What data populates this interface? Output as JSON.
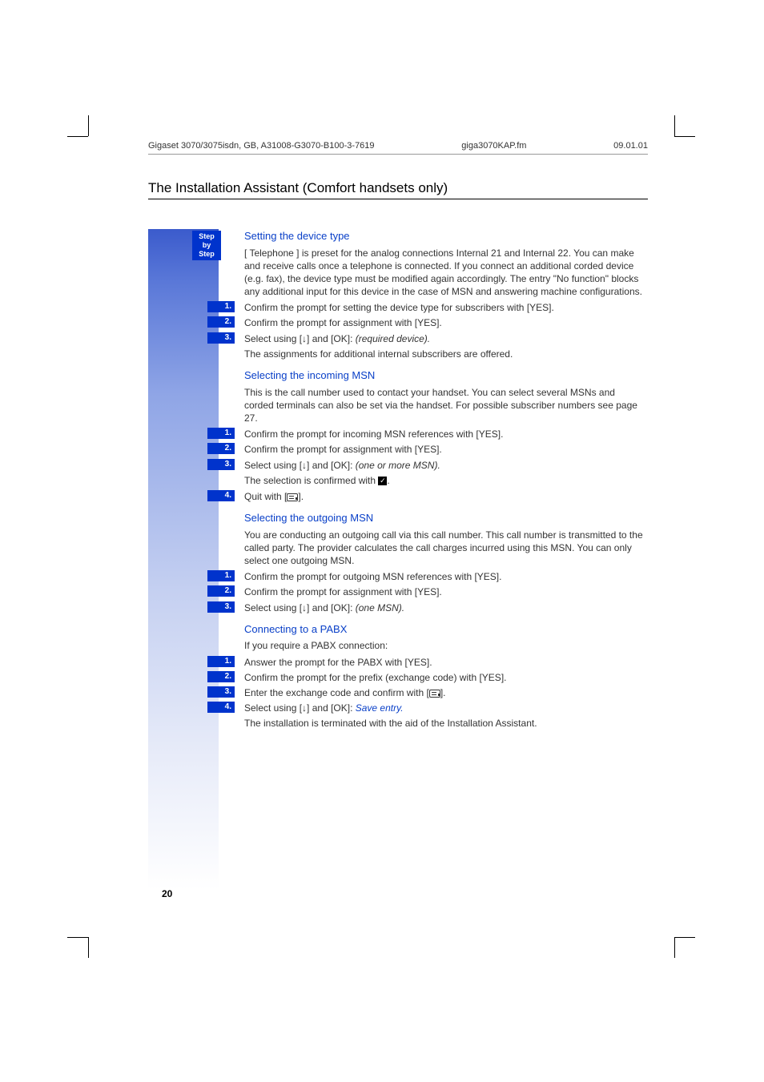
{
  "header": {
    "left": "Gigaset 3070/3075isdn, GB, A31008-G3070-B100-3-7619",
    "mid": "giga3070KAP.fm",
    "right": "09.01.01"
  },
  "section_title": "The Installation Assistant (Comfort handsets only)",
  "badge": {
    "l1": "Step",
    "l2": "by",
    "l3": "Step"
  },
  "s1": {
    "title": "Setting the device type",
    "intro": "[ Telephone ] is preset for the analog connections Internal 21 and Internal 22. You can make and receive calls once a telephone is connected. If you connect an additional corded device (e.g. fax), the device type must be modified again accordingly. The entry \"No function\" blocks any additional input for this device in the case of MSN and answering machine configurations.",
    "r1": "Confirm the prompt for setting the device type for subscribers with [YES].",
    "r2": "Confirm the prompt for assignment with [YES].",
    "r3a": "Select using [",
    "r3b": "] and [OK]: ",
    "r3i": "(required device).",
    "after": "The assignments for additional internal subscribers are offered."
  },
  "s2": {
    "title": "Selecting the incoming MSN",
    "intro": "This is the call number used to contact your handset. You can select several MSNs and corded terminals can also be set via the handset. For possible subscriber numbers see page 27.",
    "r1": "Confirm the prompt for incoming MSN references with [YES].",
    "r2": "Confirm the prompt for assignment with [YES].",
    "r3a": "Select using [",
    "r3b": "] and [OK]: ",
    "r3i": "(one or more MSN).",
    "conf_a": "The selection is confirmed with ",
    "conf_dot": ".",
    "r4a": "Quit with [",
    "r4b": "]."
  },
  "s3": {
    "title": "Selecting the outgoing MSN",
    "intro": "You are conducting an outgoing call via this call number. This call number is transmitted to the called party. The provider calculates the call charges incurred using this MSN. You can only select one outgoing MSN.",
    "r1": "Confirm the prompt for outgoing MSN references with [YES].",
    "r2": "Confirm the prompt for assignment with [YES].",
    "r3a": "Select using [",
    "r3b": "] and [OK]: ",
    "r3i": "(one MSN)."
  },
  "s4": {
    "title": "Connecting to a PABX",
    "intro": "If you require a PABX connection:",
    "r1": "Answer the prompt for the PABX with [YES].",
    "r2": "Confirm the prompt for the prefix (exchange code) with [YES].",
    "r3a": "Enter the exchange code and confirm with  [",
    "r3b": "].",
    "r4a": "Select using [",
    "r4b": "] and [OK]: ",
    "r4i": "Save entry.",
    "after": "The installation is terminated with the aid of the Installation Assistant."
  },
  "page_number": "20",
  "step_labels": {
    "n1": "1.",
    "n2": "2.",
    "n3": "3.",
    "n4": "4."
  },
  "glyphs": {
    "down_arrow": "↓",
    "check": "✓"
  }
}
